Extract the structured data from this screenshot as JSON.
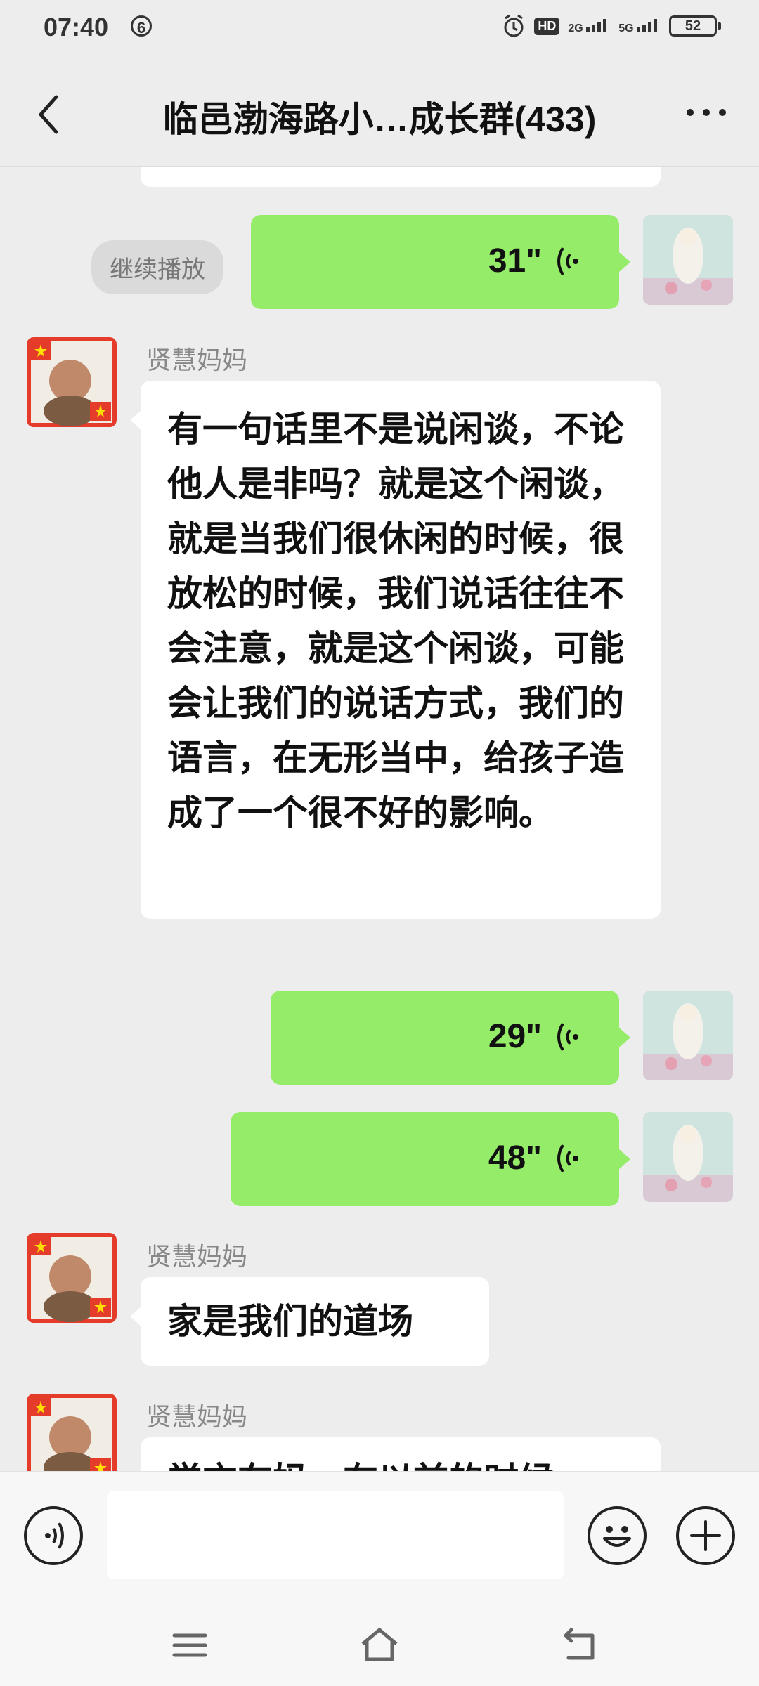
{
  "status_bar": {
    "time": "07:40",
    "notification_count": "6",
    "hd_label": "HD",
    "network_1": "2G",
    "network_2": "5G",
    "battery": "52"
  },
  "header": {
    "title": "临邑渤海路小…成长群(433)"
  },
  "messages": {
    "continue_play_label": "继续播放",
    "voice_1": "31\"",
    "sender_1": "贤慧妈妈",
    "text_1": "有一句话里不是说闲谈，不论他人是非吗？就是这个闲谈，就是当我们很休闲的时候，很放松的时候，我们说话往往不会注意，就是这个闲谈，可能会让我们的说话方式，我们的语言，在无形当中，给孩子造成了一个很不好的影响。",
    "voice_2": "29\"",
    "voice_3": "48\"",
    "sender_2": "贤慧妈妈",
    "text_2": "家是我们的道场",
    "sender_3": "贤慧妈妈",
    "text_3_partial": "学亦在妈一在以前的时候"
  },
  "colors": {
    "background": "#ededed",
    "sent_bubble": "#95ec69",
    "received_bubble": "#ffffff",
    "sender_name": "#888888"
  },
  "icons": {
    "back": "chevron-left-icon",
    "more": "more-dots-icon",
    "voice_wave": "voice-wave-icon",
    "voice_mode": "voice-mode-icon",
    "emoji": "emoji-icon",
    "plus": "plus-icon"
  }
}
